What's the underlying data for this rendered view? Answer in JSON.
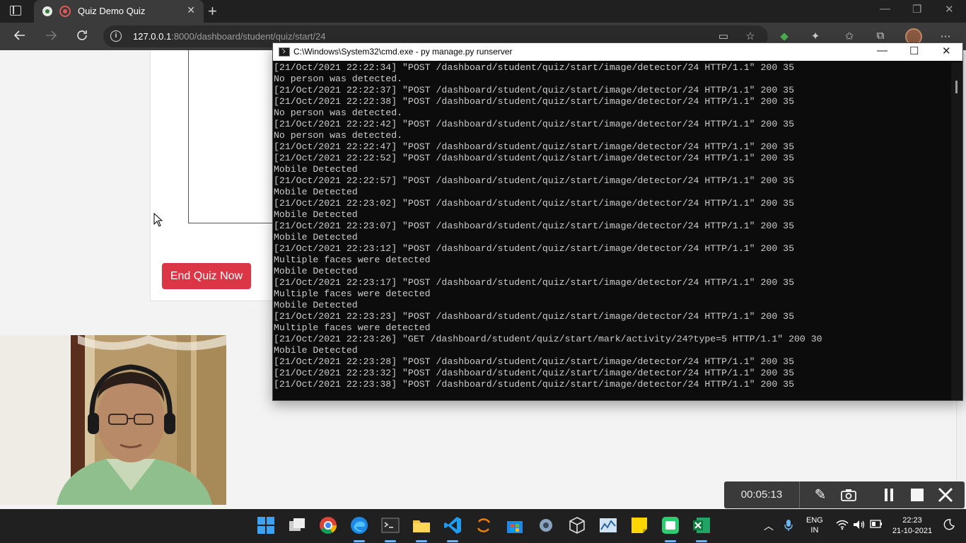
{
  "browser": {
    "tab_title": "Quiz Demo Quiz",
    "close_tab": "✕",
    "new_tab": "+",
    "url_host": "127.0.0.1",
    "url_rest": ":8000/dashboard/student/quiz/start/24",
    "back_icon": "arrow-left-icon",
    "forward_icon": "arrow-right-icon",
    "reload_icon": "reload-icon"
  },
  "page": {
    "end_quiz_button": "End Quiz Now"
  },
  "cmd": {
    "title": "C:\\Windows\\System32\\cmd.exe - py  manage.py runserver",
    "lines": [
      "[21/Oct/2021 22:22:34] \"POST /dashboard/student/quiz/start/image/detector/24 HTTP/1.1\" 200 35",
      "No person was detected.",
      "[21/Oct/2021 22:22:37] \"POST /dashboard/student/quiz/start/image/detector/24 HTTP/1.1\" 200 35",
      "[21/Oct/2021 22:22:38] \"POST /dashboard/student/quiz/start/image/detector/24 HTTP/1.1\" 200 35",
      "No person was detected.",
      "[21/Oct/2021 22:22:42] \"POST /dashboard/student/quiz/start/image/detector/24 HTTP/1.1\" 200 35",
      "No person was detected.",
      "[21/Oct/2021 22:22:47] \"POST /dashboard/student/quiz/start/image/detector/24 HTTP/1.1\" 200 35",
      "[21/Oct/2021 22:22:52] \"POST /dashboard/student/quiz/start/image/detector/24 HTTP/1.1\" 200 35",
      "Mobile Detected",
      "[21/Oct/2021 22:22:57] \"POST /dashboard/student/quiz/start/image/detector/24 HTTP/1.1\" 200 35",
      "Mobile Detected",
      "[21/Oct/2021 22:23:02] \"POST /dashboard/student/quiz/start/image/detector/24 HTTP/1.1\" 200 35",
      "Mobile Detected",
      "[21/Oct/2021 22:23:07] \"POST /dashboard/student/quiz/start/image/detector/24 HTTP/1.1\" 200 35",
      "Mobile Detected",
      "[21/Oct/2021 22:23:12] \"POST /dashboard/student/quiz/start/image/detector/24 HTTP/1.1\" 200 35",
      "Multiple faces were detected",
      "Mobile Detected",
      "[21/Oct/2021 22:23:17] \"POST /dashboard/student/quiz/start/image/detector/24 HTTP/1.1\" 200 35",
      "Multiple faces were detected",
      "Mobile Detected",
      "[21/Oct/2021 22:23:23] \"POST /dashboard/student/quiz/start/image/detector/24 HTTP/1.1\" 200 35",
      "Multiple faces were detected",
      "[21/Oct/2021 22:23:26] \"GET /dashboard/student/quiz/start/mark/activity/24?type=5 HTTP/1.1\" 200 30",
      "Mobile Detected",
      "[21/Oct/2021 22:23:28] \"POST /dashboard/student/quiz/start/image/detector/24 HTTP/1.1\" 200 35",
      "[21/Oct/2021 22:23:32] \"POST /dashboard/student/quiz/start/image/detector/24 HTTP/1.1\" 200 35",
      "[21/Oct/2021 22:23:38] \"POST /dashboard/student/quiz/start/image/detector/24 HTTP/1.1\" 200 35"
    ]
  },
  "recorder": {
    "timer": "00:05:13"
  },
  "taskbar": {
    "lang_line1": "ENG",
    "lang_line2": "IN",
    "time": "22:23",
    "date": "21-10-2021"
  },
  "colors": {
    "end_button": "#dc3545",
    "console_bg": "#0c0c0c",
    "console_text": "#cccccc"
  }
}
